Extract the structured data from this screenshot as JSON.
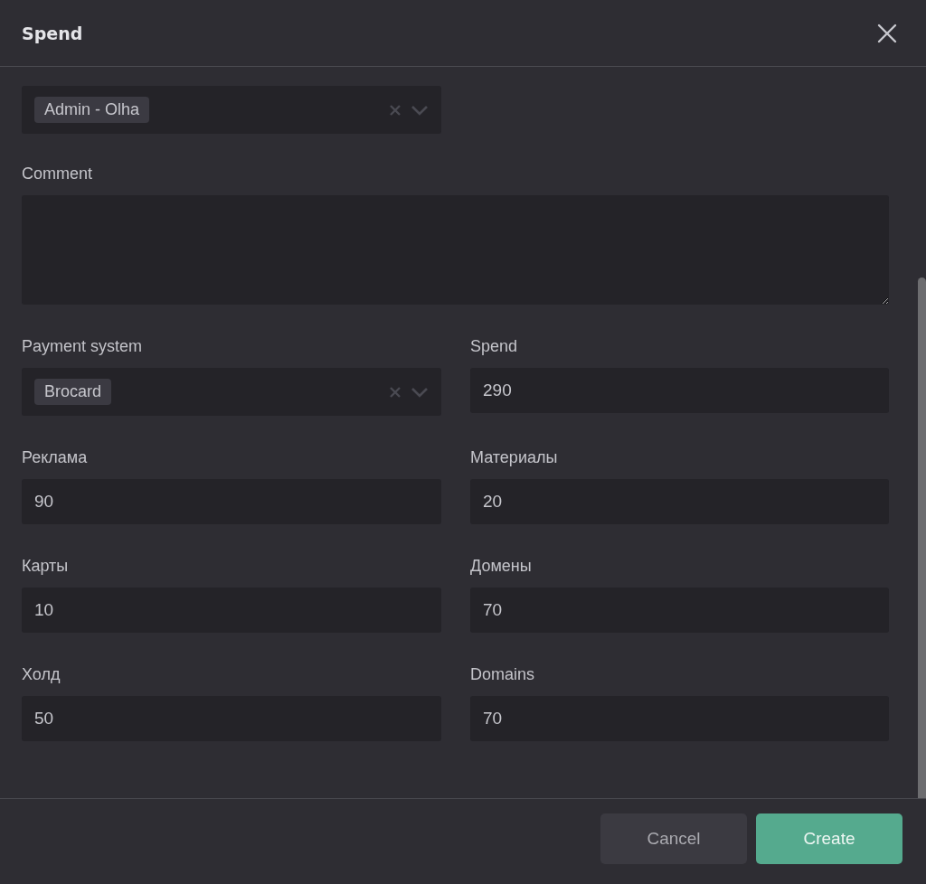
{
  "window": {
    "title": "Spend"
  },
  "user_select": {
    "tags": [
      "Admin - Olha"
    ]
  },
  "comment": {
    "label": "Comment"
  },
  "fields": [
    {
      "kind": "select",
      "label": "Payment system",
      "tags": [
        "Brocard"
      ]
    },
    {
      "kind": "input",
      "label": "Spend",
      "value": "290"
    },
    {
      "kind": "input",
      "label": "Реклама",
      "value": "90"
    },
    {
      "kind": "input",
      "label": "Материалы",
      "value": "20"
    },
    {
      "kind": "input",
      "label": "Карты",
      "value": "10"
    },
    {
      "kind": "input",
      "label": "Домены",
      "value": "70"
    },
    {
      "kind": "input",
      "label": "Холд",
      "value": "50"
    },
    {
      "kind": "input",
      "label": "Domains",
      "value": "70"
    }
  ],
  "buttons": [
    {
      "kind": "secondary",
      "label": "Cancel"
    },
    {
      "kind": "primary",
      "label": "Create"
    }
  ]
}
